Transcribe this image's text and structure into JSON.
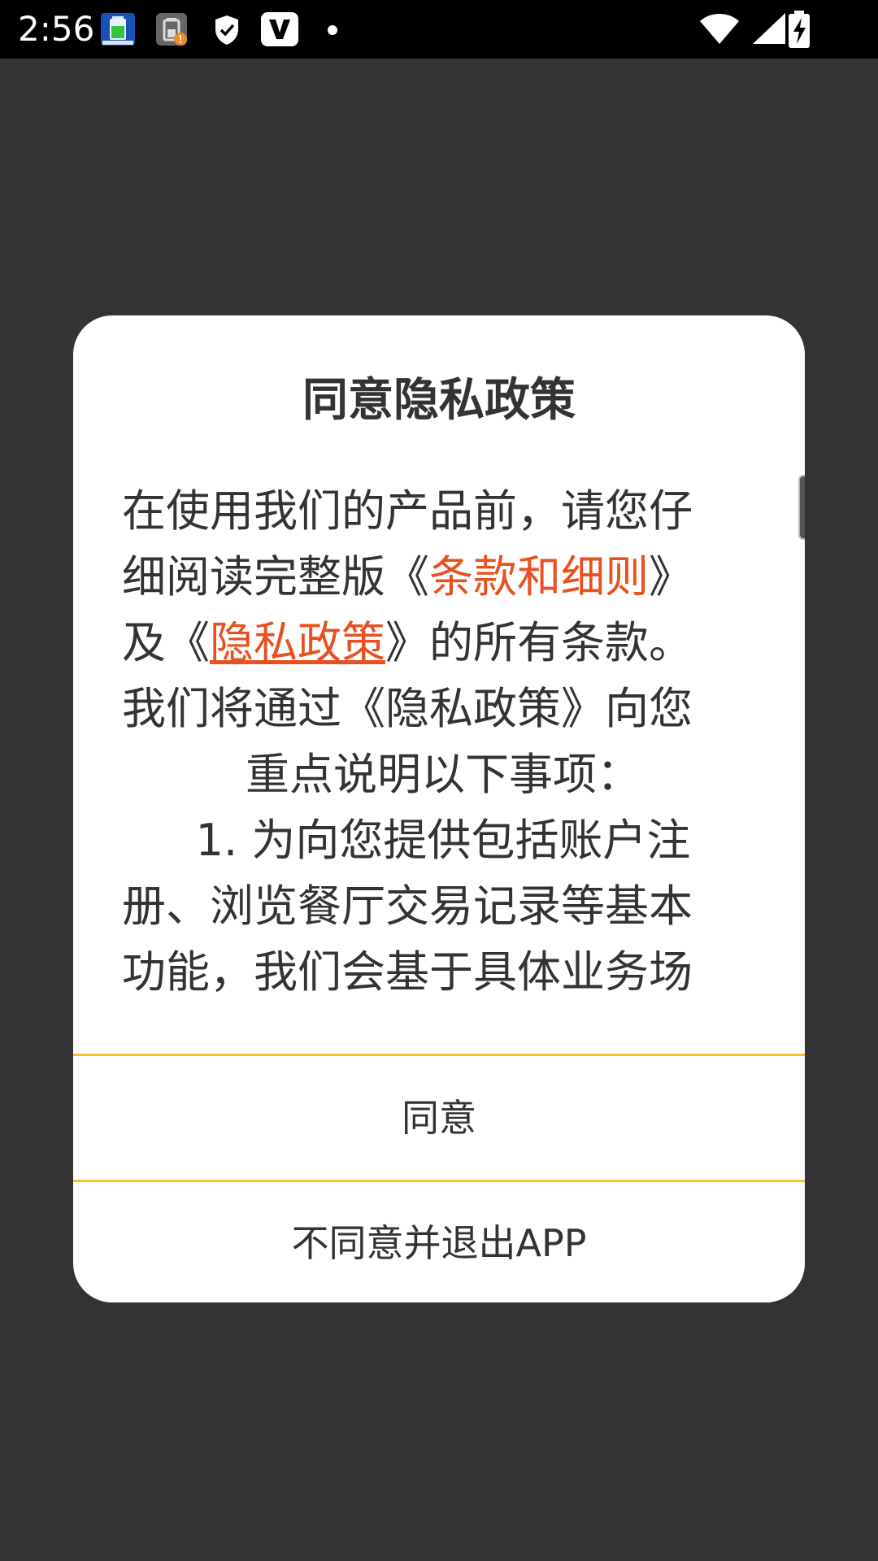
{
  "status_bar": {
    "time": "2:56",
    "icons": [
      "battery-app-icon",
      "battery-alert-icon",
      "shield-icon",
      "v-app-icon",
      "notification-dot-icon",
      "wifi-icon",
      "signal-icon",
      "battery-charging-icon"
    ]
  },
  "dialog": {
    "title": "同意隐私政策",
    "content": {
      "line1": "在使用我们的产品前，请您仔",
      "line2_prefix": "细阅读完整版《",
      "terms_link": "条款和细则",
      "line2_suffix": "》",
      "line3_prefix": "及《",
      "privacy_link": "隐私政策",
      "line3_suffix": "》的所有条款。",
      "line4": "我们将通过《隐私政策》向您",
      "line5": "重点说明以下事项：",
      "line6": "1. 为向您提供包括账户注",
      "line7": "册、浏览餐厅交易记录等基本",
      "line8": "功能，我们会基于具体业务场"
    },
    "agree_button": "同意",
    "disagree_button": "不同意并退出APP"
  },
  "colors": {
    "background": "#333333",
    "link": "#e8501f",
    "divider": "#f2c12e",
    "text": "#333333"
  }
}
